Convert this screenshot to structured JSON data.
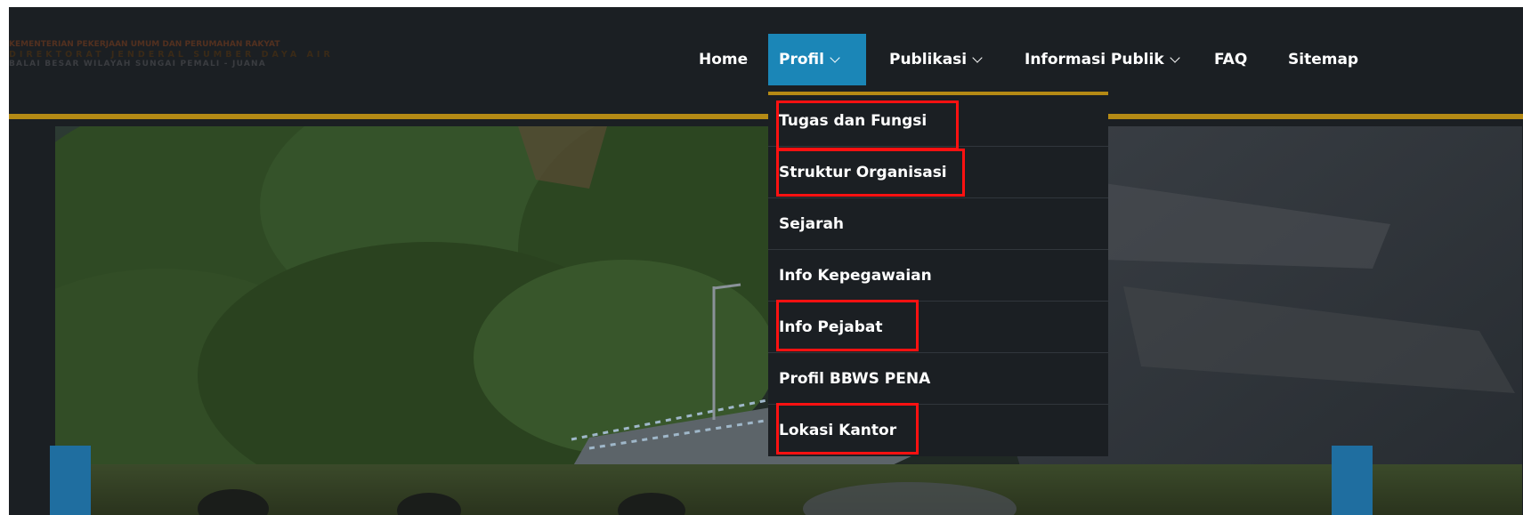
{
  "logo": {
    "line1": "KEMENTERIAN PEKERJAAN UMUM DAN PERUMAHAN RAKYAT",
    "line2": "DIREKTORAT JENDERAL SUMBER DAYA AIR",
    "line3": "BALAI BESAR WILAYAH SUNGAI PEMALI - JUANA"
  },
  "nav": {
    "home": "Home",
    "profil": "Profil",
    "publikasi": "Publikasi",
    "informasi_publik": "Informasi Publik",
    "faq": "FAQ",
    "sitemap": "Sitemap"
  },
  "dropdown": {
    "items": [
      "Tugas dan Fungsi",
      "Struktur Organisasi",
      "Sejarah",
      "Info Kepegawaian",
      "Info Pejabat",
      "Profil BBWS PENA",
      "Lokasi Kantor"
    ]
  },
  "colors": {
    "header_bg": "#1b1f23",
    "active_nav": "#1b86b7",
    "gold_bar": "#b58a15",
    "highlight": "#ff1111"
  }
}
